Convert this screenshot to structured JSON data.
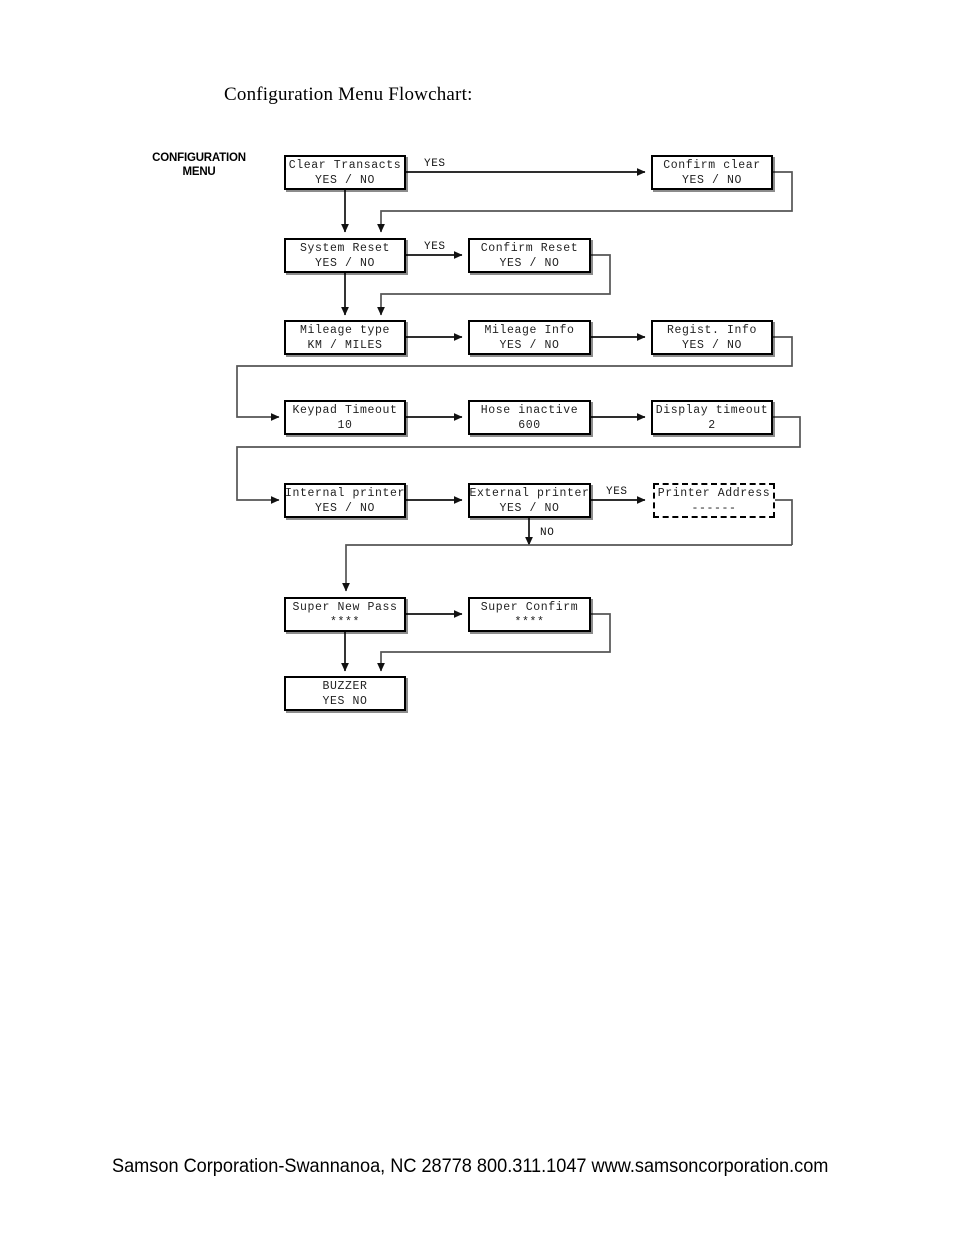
{
  "page": {
    "title": "Configuration Menu Flowchart:",
    "menu_label_line1": "CONFIGURATION",
    "menu_label_line2": "MENU",
    "footer": "Samson Corporation-Swannanoa, NC 28778  800.311.1047 www.samsoncorporation.com",
    "ink_color": "#000000",
    "paper_color": "#ffffff"
  },
  "nodes": [
    {
      "id": "clear-transacts",
      "line1": "Clear Transacts",
      "line2": "YES / NO",
      "style": "solid"
    },
    {
      "id": "confirm-clear",
      "line1": "Confirm clear",
      "line2": "YES / NO",
      "style": "solid"
    },
    {
      "id": "system-reset",
      "line1": "System Reset",
      "line2": "YES / NO",
      "style": "solid"
    },
    {
      "id": "confirm-reset",
      "line1": "Confirm Reset",
      "line2": "YES / NO",
      "style": "solid"
    },
    {
      "id": "mileage-type",
      "line1": "Mileage type",
      "line2": "KM / MILES",
      "style": "solid"
    },
    {
      "id": "mileage-info",
      "line1": "Mileage Info",
      "line2": "YES / NO",
      "style": "solid"
    },
    {
      "id": "regist-info",
      "line1": "Regist. Info",
      "line2": "YES / NO",
      "style": "solid"
    },
    {
      "id": "keypad-timeout",
      "line1": "Keypad Timeout",
      "line2": "10",
      "style": "solid"
    },
    {
      "id": "hose-inactive",
      "line1": "Hose inactive",
      "line2": "600",
      "style": "solid"
    },
    {
      "id": "display-timeout",
      "line1": "Display timeout",
      "line2": "2",
      "style": "solid"
    },
    {
      "id": "internal-printer",
      "line1": "Internal printer",
      "line2": "YES / NO",
      "style": "solid"
    },
    {
      "id": "external-printer",
      "line1": "External printer",
      "line2": "YES / NO",
      "style": "solid"
    },
    {
      "id": "printer-address",
      "line1": "Printer Address",
      "line2": "------",
      "style": "dashed"
    },
    {
      "id": "super-new-pass",
      "line1": "Super New Pass",
      "line2": "****",
      "style": "solid"
    },
    {
      "id": "super-confirm",
      "line1": "Super Confirm",
      "line2": "****",
      "style": "solid"
    },
    {
      "id": "buzzer",
      "line1": "BUZZER",
      "line2": "YES   NO",
      "style": "solid"
    }
  ],
  "edge_labels": {
    "clear_yes": "YES",
    "reset_yes": "YES",
    "printer_yes": "YES",
    "printer_no": "NO"
  }
}
